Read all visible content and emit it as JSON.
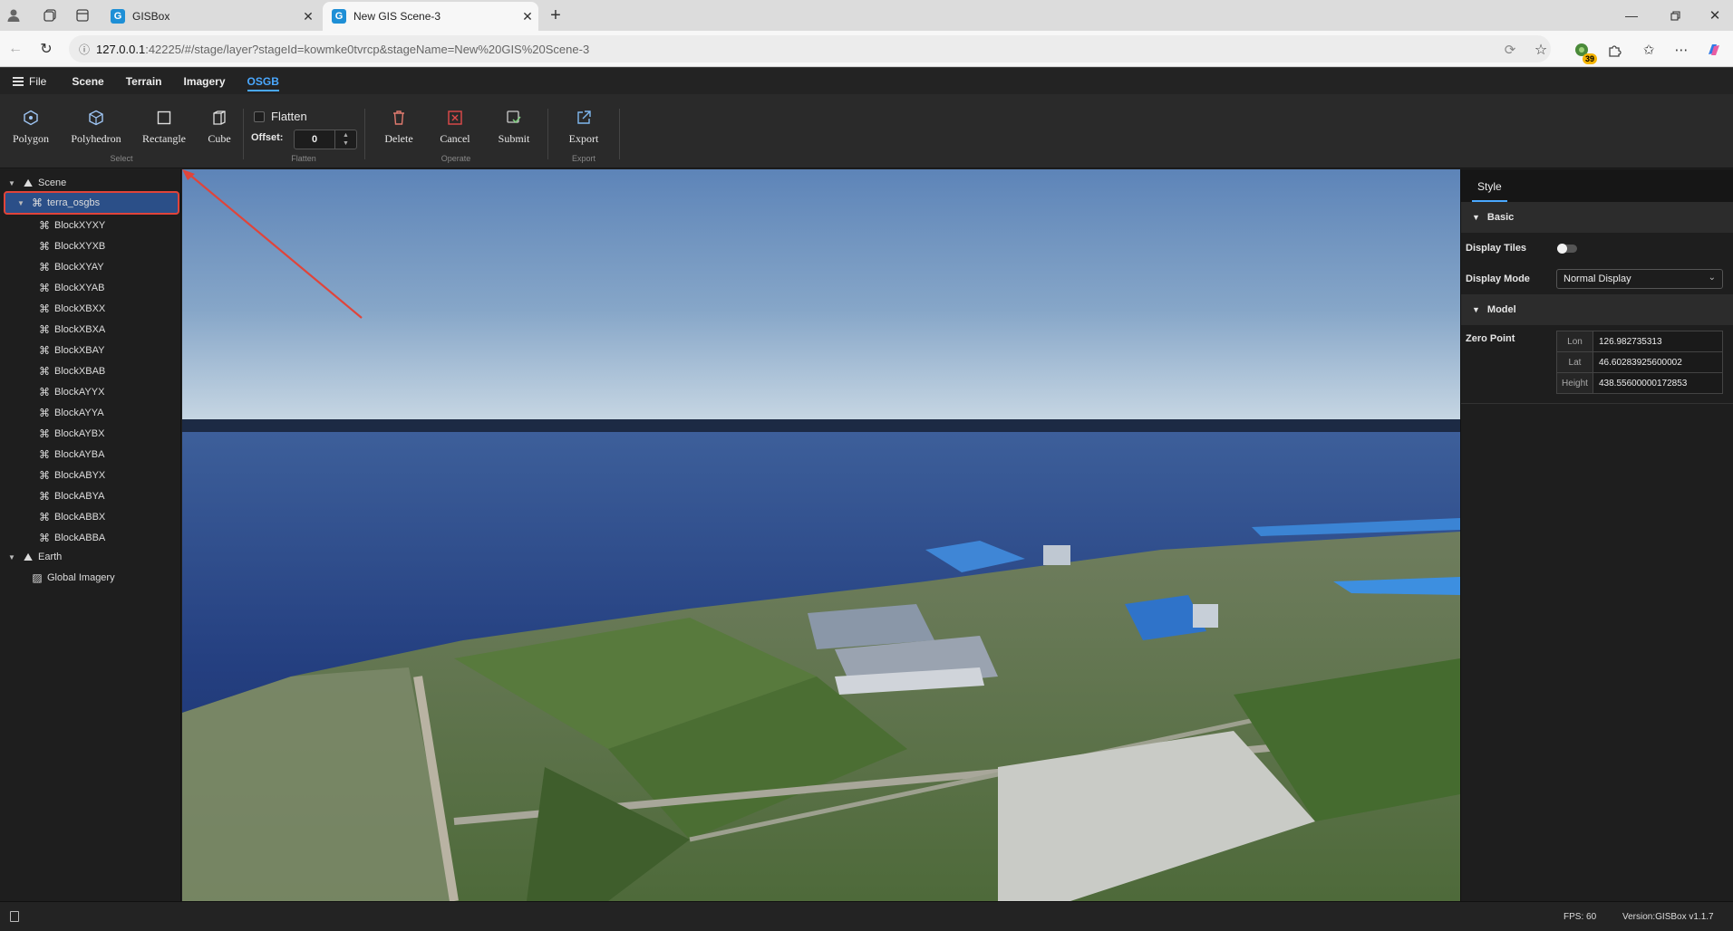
{
  "browser": {
    "tabs": [
      {
        "title": "GISBox",
        "favicon": "G",
        "active": false
      },
      {
        "title": "New GIS Scene-3",
        "favicon": "G",
        "active": true
      }
    ],
    "url_host": "127.0.0.1",
    "url_rest": ":42225/#/stage/layer?stageId=kowmke0tvrcp&stageName=New%20GIS%20Scene-3",
    "extension_badge": "39"
  },
  "menubar": {
    "file_label": "File",
    "tabs": [
      "Scene",
      "Terrain",
      "Imagery",
      "OSGB"
    ],
    "active_tab": "OSGB"
  },
  "toolbar": {
    "select_tools": [
      "Polygon",
      "Polyhedron",
      "Rectangle",
      "Cube"
    ],
    "select_group": "Select",
    "flatten_label": "Flatten",
    "offset_label": "Offset:",
    "offset_value": "0",
    "flatten_group": "Flatten",
    "operate_tools": [
      "Delete",
      "Cancel",
      "Submit"
    ],
    "operate_group": "Operate",
    "export_label": "Export",
    "export_group": "Export"
  },
  "layer_tree": {
    "scene_label": "Scene",
    "selected_layer": "terra_osgbs",
    "blocks": [
      "BlockXYXY",
      "BlockXYXB",
      "BlockXYAY",
      "BlockXYAB",
      "BlockXBXX",
      "BlockXBXA",
      "BlockXBAY",
      "BlockXBAB",
      "BlockAYYX",
      "BlockAYYA",
      "BlockAYBX",
      "BlockAYBA",
      "BlockABYX",
      "BlockABYA",
      "BlockABBX",
      "BlockABBA"
    ],
    "earth_label": "Earth",
    "earth_children": [
      "Global Imagery"
    ]
  },
  "properties": {
    "tab": "Style",
    "basic_section": "Basic",
    "display_tiles_label": "Display Tiles",
    "display_tiles_on": false,
    "display_mode_label": "Display Mode",
    "display_mode_value": "Normal Display",
    "model_section": "Model",
    "zero_point_label": "Zero Point",
    "lon_label": "Lon",
    "lon_value": "126.982735313",
    "lat_label": "Lat",
    "lat_value": "46.60283925600002",
    "height_label": "Height",
    "height_value": "438.55600000172853"
  },
  "status": {
    "fps": "FPS: 60",
    "version": "Version:GISBox v1.1.7"
  },
  "colors": {
    "accent": "#4aa8ff",
    "selection_bg": "#2b4f88",
    "annotation_red": "#e0443a"
  }
}
